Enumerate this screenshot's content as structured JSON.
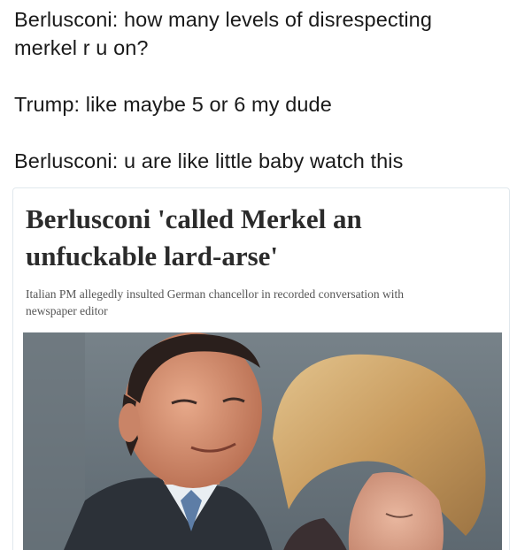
{
  "post": {
    "lines": [
      "Berlusconi: how many levels of disrespecting",
      "merkel r u on?",
      "Trump: like maybe 5 or 6 my dude",
      "Berlusconi: u are like little baby watch this"
    ]
  },
  "article": {
    "headline_line1": "Berlusconi 'called Merkel an",
    "headline_line2": "unfuckable lard-arse'",
    "standfirst_line1": "Italian PM allegedly insulted German chancellor in recorded conversation with",
    "standfirst_line2": "newspaper editor"
  },
  "colors": {
    "text": "#1a1a1a",
    "headline": "#2b2b2b",
    "standfirst": "#555555",
    "card_border": "#e1e8ed"
  }
}
